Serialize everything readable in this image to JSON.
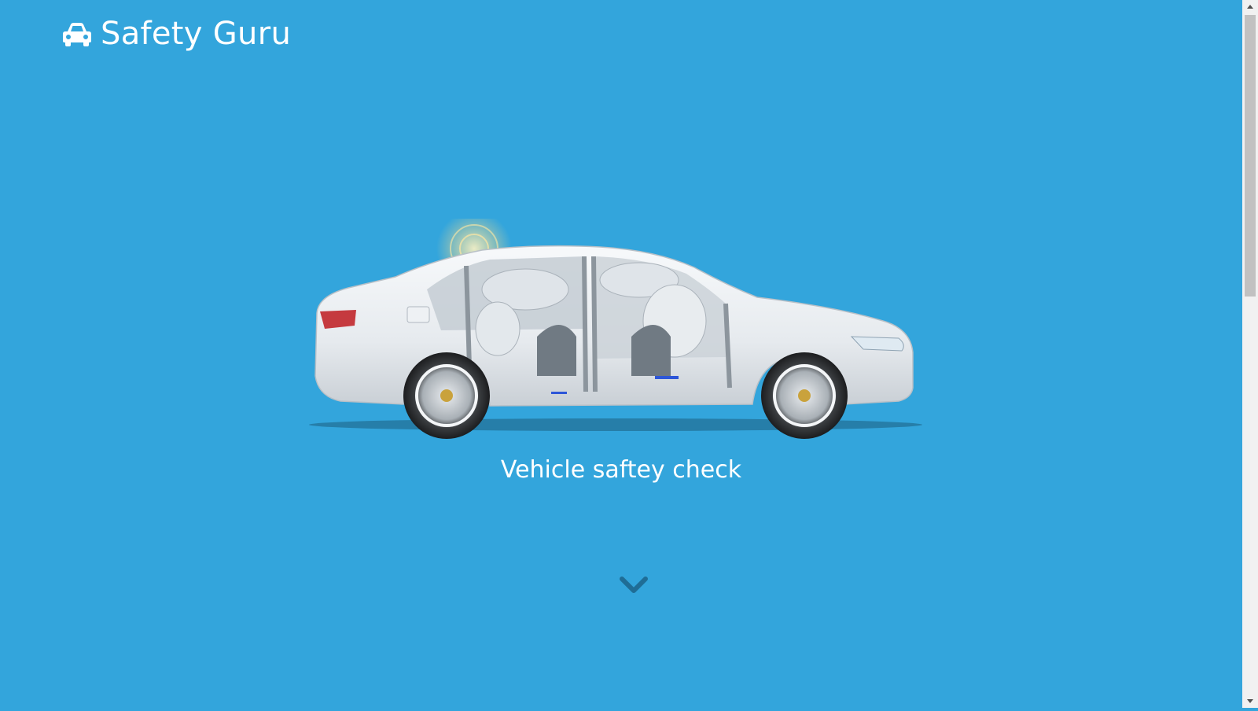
{
  "header": {
    "brand_name": "Safety Guru",
    "brand_icon": "car-icon"
  },
  "hero": {
    "image": "vehicle-cutaway-airbags",
    "caption": "Vehicle saftey check"
  },
  "scroll_hint": {
    "icon": "chevron-down-icon"
  },
  "colors": {
    "background": "#33a5dc",
    "text": "#ffffff",
    "chevron": "#1f6d96"
  }
}
